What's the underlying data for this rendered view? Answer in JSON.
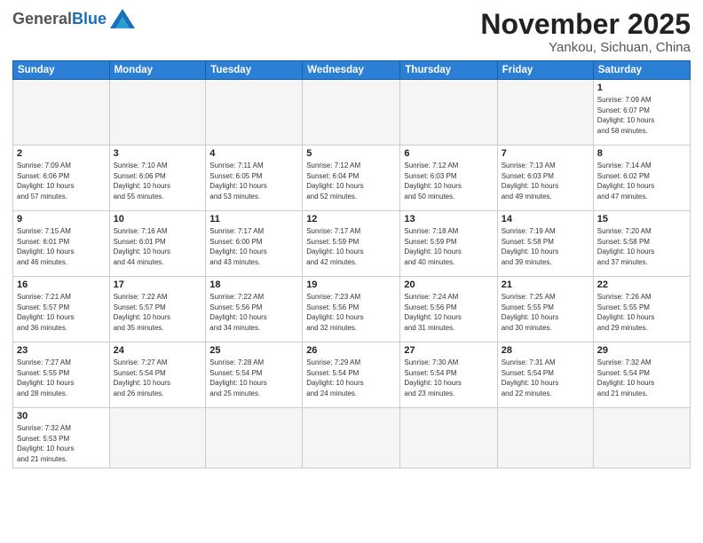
{
  "header": {
    "logo_general": "General",
    "logo_blue": "Blue",
    "month": "November 2025",
    "location": "Yankou, Sichuan, China"
  },
  "days_of_week": [
    "Sunday",
    "Monday",
    "Tuesday",
    "Wednesday",
    "Thursday",
    "Friday",
    "Saturday"
  ],
  "weeks": [
    [
      {
        "day": "",
        "info": ""
      },
      {
        "day": "",
        "info": ""
      },
      {
        "day": "",
        "info": ""
      },
      {
        "day": "",
        "info": ""
      },
      {
        "day": "",
        "info": ""
      },
      {
        "day": "",
        "info": ""
      },
      {
        "day": "1",
        "info": "Sunrise: 7:09 AM\nSunset: 6:07 PM\nDaylight: 10 hours\nand 58 minutes."
      }
    ],
    [
      {
        "day": "2",
        "info": "Sunrise: 7:09 AM\nSunset: 6:06 PM\nDaylight: 10 hours\nand 57 minutes."
      },
      {
        "day": "3",
        "info": "Sunrise: 7:10 AM\nSunset: 6:06 PM\nDaylight: 10 hours\nand 55 minutes."
      },
      {
        "day": "4",
        "info": "Sunrise: 7:11 AM\nSunset: 6:05 PM\nDaylight: 10 hours\nand 53 minutes."
      },
      {
        "day": "5",
        "info": "Sunrise: 7:12 AM\nSunset: 6:04 PM\nDaylight: 10 hours\nand 52 minutes."
      },
      {
        "day": "6",
        "info": "Sunrise: 7:12 AM\nSunset: 6:03 PM\nDaylight: 10 hours\nand 50 minutes."
      },
      {
        "day": "7",
        "info": "Sunrise: 7:13 AM\nSunset: 6:03 PM\nDaylight: 10 hours\nand 49 minutes."
      },
      {
        "day": "8",
        "info": "Sunrise: 7:14 AM\nSunset: 6:02 PM\nDaylight: 10 hours\nand 47 minutes."
      }
    ],
    [
      {
        "day": "9",
        "info": "Sunrise: 7:15 AM\nSunset: 6:01 PM\nDaylight: 10 hours\nand 46 minutes."
      },
      {
        "day": "10",
        "info": "Sunrise: 7:16 AM\nSunset: 6:01 PM\nDaylight: 10 hours\nand 44 minutes."
      },
      {
        "day": "11",
        "info": "Sunrise: 7:17 AM\nSunset: 6:00 PM\nDaylight: 10 hours\nand 43 minutes."
      },
      {
        "day": "12",
        "info": "Sunrise: 7:17 AM\nSunset: 5:59 PM\nDaylight: 10 hours\nand 42 minutes."
      },
      {
        "day": "13",
        "info": "Sunrise: 7:18 AM\nSunset: 5:59 PM\nDaylight: 10 hours\nand 40 minutes."
      },
      {
        "day": "14",
        "info": "Sunrise: 7:19 AM\nSunset: 5:58 PM\nDaylight: 10 hours\nand 39 minutes."
      },
      {
        "day": "15",
        "info": "Sunrise: 7:20 AM\nSunset: 5:58 PM\nDaylight: 10 hours\nand 37 minutes."
      }
    ],
    [
      {
        "day": "16",
        "info": "Sunrise: 7:21 AM\nSunset: 5:57 PM\nDaylight: 10 hours\nand 36 minutes."
      },
      {
        "day": "17",
        "info": "Sunrise: 7:22 AM\nSunset: 5:57 PM\nDaylight: 10 hours\nand 35 minutes."
      },
      {
        "day": "18",
        "info": "Sunrise: 7:22 AM\nSunset: 5:56 PM\nDaylight: 10 hours\nand 34 minutes."
      },
      {
        "day": "19",
        "info": "Sunrise: 7:23 AM\nSunset: 5:56 PM\nDaylight: 10 hours\nand 32 minutes."
      },
      {
        "day": "20",
        "info": "Sunrise: 7:24 AM\nSunset: 5:56 PM\nDaylight: 10 hours\nand 31 minutes."
      },
      {
        "day": "21",
        "info": "Sunrise: 7:25 AM\nSunset: 5:55 PM\nDaylight: 10 hours\nand 30 minutes."
      },
      {
        "day": "22",
        "info": "Sunrise: 7:26 AM\nSunset: 5:55 PM\nDaylight: 10 hours\nand 29 minutes."
      }
    ],
    [
      {
        "day": "23",
        "info": "Sunrise: 7:27 AM\nSunset: 5:55 PM\nDaylight: 10 hours\nand 28 minutes."
      },
      {
        "day": "24",
        "info": "Sunrise: 7:27 AM\nSunset: 5:54 PM\nDaylight: 10 hours\nand 26 minutes."
      },
      {
        "day": "25",
        "info": "Sunrise: 7:28 AM\nSunset: 5:54 PM\nDaylight: 10 hours\nand 25 minutes."
      },
      {
        "day": "26",
        "info": "Sunrise: 7:29 AM\nSunset: 5:54 PM\nDaylight: 10 hours\nand 24 minutes."
      },
      {
        "day": "27",
        "info": "Sunrise: 7:30 AM\nSunset: 5:54 PM\nDaylight: 10 hours\nand 23 minutes."
      },
      {
        "day": "28",
        "info": "Sunrise: 7:31 AM\nSunset: 5:54 PM\nDaylight: 10 hours\nand 22 minutes."
      },
      {
        "day": "29",
        "info": "Sunrise: 7:32 AM\nSunset: 5:54 PM\nDaylight: 10 hours\nand 21 minutes."
      }
    ],
    [
      {
        "day": "30",
        "info": "Sunrise: 7:32 AM\nSunset: 5:53 PM\nDaylight: 10 hours\nand 21 minutes."
      },
      {
        "day": "",
        "info": ""
      },
      {
        "day": "",
        "info": ""
      },
      {
        "day": "",
        "info": ""
      },
      {
        "day": "",
        "info": ""
      },
      {
        "day": "",
        "info": ""
      },
      {
        "day": "",
        "info": ""
      }
    ]
  ]
}
